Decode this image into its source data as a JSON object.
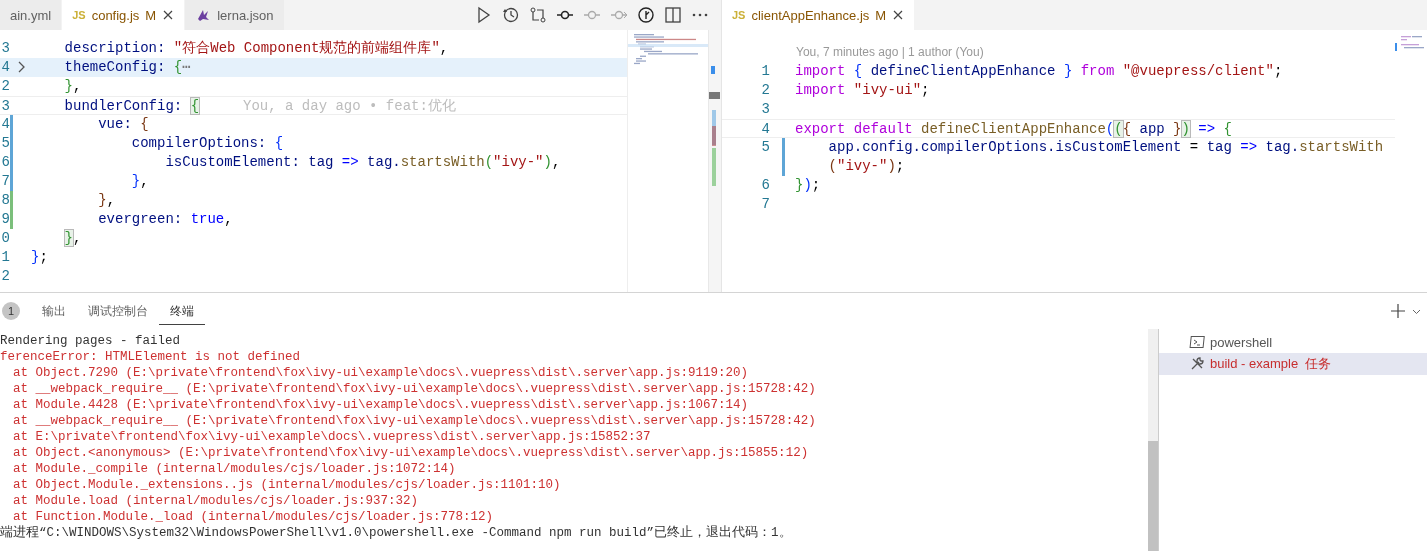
{
  "left_editor": {
    "tabs": [
      {
        "label": "ain.yml",
        "selected": false,
        "modified": false,
        "kind": "plain"
      },
      {
        "label": "config.js",
        "selected": true,
        "modified": true,
        "badge": "M",
        "icon_text": "JS",
        "kind": "js"
      },
      {
        "label": "lerna.json",
        "selected": false,
        "modified": false,
        "kind": "json"
      }
    ],
    "lines": [
      {
        "number": "3",
        "highlighted": false,
        "current": false,
        "folded": false,
        "modified": false,
        "added": false,
        "tokens": [
          {
            "text": "    description: ",
            "kind": "prop"
          },
          {
            "text": "\"符合Web Component规范的前端组件库\"",
            "kind": "str"
          },
          {
            "text": ",",
            "kind": "plain"
          }
        ]
      },
      {
        "number": "4",
        "highlighted": true,
        "current": false,
        "folded": true,
        "modified": false,
        "added": false,
        "tokens": [
          {
            "text": "    themeConfig: ",
            "kind": "prop"
          },
          {
            "text": "{",
            "kind": "b2"
          },
          {
            "text": "⋯",
            "kind": "fold"
          }
        ]
      },
      {
        "number": "2",
        "highlighted": false,
        "current": false,
        "folded": false,
        "modified": false,
        "added": false,
        "tokens": [
          {
            "text": "    }",
            "kind": "b2"
          },
          {
            "text": ",",
            "kind": "plain"
          }
        ]
      },
      {
        "number": "3",
        "highlighted": false,
        "current": true,
        "folded": false,
        "modified": false,
        "added": false,
        "tokens": [
          {
            "text": "    bundlerConfig: ",
            "kind": "prop"
          },
          {
            "text": "{",
            "kind": "match"
          }
        ],
        "blame": "You, a day ago • feat:优化"
      },
      {
        "number": "4",
        "highlighted": false,
        "current": false,
        "folded": false,
        "modified": true,
        "added": false,
        "tokens": [
          {
            "text": "        vue: ",
            "kind": "prop"
          },
          {
            "text": "{",
            "kind": "b3"
          }
        ]
      },
      {
        "number": "5",
        "highlighted": false,
        "current": false,
        "folded": false,
        "modified": true,
        "added": false,
        "tokens": [
          {
            "text": "            compilerOptions: ",
            "kind": "prop"
          },
          {
            "text": "{",
            "kind": "b1"
          }
        ]
      },
      {
        "number": "6",
        "highlighted": false,
        "current": false,
        "folded": false,
        "modified": true,
        "added": false,
        "tokens": [
          {
            "text": "                isCustomElement: ",
            "kind": "prop"
          },
          {
            "text": "tag ",
            "kind": "prop"
          },
          {
            "text": "=>",
            "kind": "kw"
          },
          {
            "text": " tag.",
            "kind": "prop"
          },
          {
            "text": "startsWith",
            "kind": "fn"
          },
          {
            "text": "(",
            "kind": "b2"
          },
          {
            "text": "\"ivy-\"",
            "kind": "str"
          },
          {
            "text": ")",
            "kind": "b2"
          },
          {
            "text": ",",
            "kind": "plain"
          }
        ]
      },
      {
        "number": "7",
        "highlighted": false,
        "current": false,
        "folded": false,
        "modified": true,
        "added": false,
        "tokens": [
          {
            "text": "            }",
            "kind": "b1"
          },
          {
            "text": ",",
            "kind": "plain"
          }
        ]
      },
      {
        "number": "8",
        "highlighted": false,
        "current": false,
        "folded": false,
        "modified": false,
        "added": true,
        "tokens": [
          {
            "text": "        }",
            "kind": "b3"
          },
          {
            "text": ",",
            "kind": "plain"
          }
        ]
      },
      {
        "number": "9",
        "highlighted": false,
        "current": false,
        "folded": false,
        "modified": false,
        "added": true,
        "tokens": [
          {
            "text": "        evergreen: ",
            "kind": "prop"
          },
          {
            "text": "true",
            "kind": "kw"
          },
          {
            "text": ",",
            "kind": "plain"
          }
        ]
      },
      {
        "number": "0",
        "highlighted": false,
        "current": false,
        "folded": false,
        "modified": false,
        "added": false,
        "tokens": [
          {
            "text": "    }",
            "kind": "match"
          },
          {
            "text": ",",
            "kind": "plain"
          }
        ]
      },
      {
        "number": "1",
        "highlighted": false,
        "current": false,
        "folded": false,
        "modified": false,
        "added": false,
        "tokens": [
          {
            "text": "}",
            "kind": "b1"
          },
          {
            "text": ";",
            "kind": "plain"
          }
        ]
      },
      {
        "number": "2",
        "highlighted": false,
        "current": false,
        "folded": false,
        "modified": false,
        "added": false
      }
    ]
  },
  "right_editor": {
    "tabs": [
      {
        "label": "clientAppEnhance.js",
        "selected": true,
        "modified": true,
        "badge": "M",
        "icon_text": "JS",
        "kind": "js"
      }
    ],
    "codelens": "You, 7 minutes ago | 1 author (You)",
    "lines": [
      {
        "number": "1",
        "highlighted": false,
        "current": false,
        "folded": false,
        "modified": false,
        "added": false,
        "tokens": [
          {
            "text": "import",
            "kind": "ctl"
          },
          {
            "text": " {",
            "kind": "b1"
          },
          {
            "text": " defineClientAppEnhance ",
            "kind": "prop"
          },
          {
            "text": "}",
            "kind": "b1"
          },
          {
            "text": " from",
            "kind": "ctl"
          },
          {
            "text": " \"@vuepress/client\"",
            "kind": "str"
          },
          {
            "text": ";",
            "kind": "plain"
          }
        ]
      },
      {
        "number": "2",
        "highlighted": false,
        "current": false,
        "folded": false,
        "modified": false,
        "added": false,
        "tokens": [
          {
            "text": "import",
            "kind": "ctl"
          },
          {
            "text": " \"ivy-ui\"",
            "kind": "str"
          },
          {
            "text": ";",
            "kind": "plain"
          }
        ]
      },
      {
        "number": "3",
        "highlighted": false,
        "current": false,
        "folded": false,
        "modified": false,
        "added": false
      },
      {
        "number": "4",
        "highlighted": false,
        "current": true,
        "folded": false,
        "modified": false,
        "added": false,
        "tokens": [
          {
            "text": "export default",
            "kind": "ctl"
          },
          {
            "text": " defineClientAppEnhance",
            "kind": "fn"
          },
          {
            "text": "(",
            "kind": "b1"
          },
          {
            "text": "(",
            "kind": "match"
          },
          {
            "text": "{",
            "kind": "b3"
          },
          {
            "text": " app ",
            "kind": "prop"
          },
          {
            "text": "}",
            "kind": "b3"
          },
          {
            "text": ")",
            "kind": "match"
          },
          {
            "text": " => ",
            "kind": "kw"
          },
          {
            "text": "{",
            "kind": "b2"
          }
        ]
      },
      {
        "number": "5",
        "highlighted": false,
        "current": false,
        "folded": false,
        "modified": true,
        "added": false,
        "tokens": [
          {
            "text": "    app.config.compilerOptions.isCustomElement",
            "kind": "prop"
          },
          {
            "text": " = ",
            "kind": "plain"
          },
          {
            "text": "tag",
            "kind": "prop"
          },
          {
            "text": " => ",
            "kind": "kw"
          },
          {
            "text": "tag.",
            "kind": "prop"
          },
          {
            "text": "startsWith",
            "kind": "fn"
          },
          {
            "kind": "wrap"
          },
          {
            "text": "(",
            "kind": "b3"
          },
          {
            "text": "\"ivy-\"",
            "kind": "str"
          },
          {
            "text": ")",
            "kind": "b3"
          },
          {
            "text": ";",
            "kind": "plain"
          }
        ]
      },
      {
        "number": "6",
        "highlighted": false,
        "current": false,
        "folded": false,
        "modified": false,
        "added": false,
        "tokens": [
          {
            "text": "}",
            "kind": "b2"
          },
          {
            "text": ")",
            "kind": "b1"
          },
          {
            "text": ";",
            "kind": "plain"
          }
        ]
      },
      {
        "number": "7",
        "highlighted": false,
        "current": false,
        "folded": false,
        "modified": false,
        "added": false
      }
    ]
  },
  "panel": {
    "tabs": [
      {
        "count": "1",
        "selected": false
      },
      {
        "label": "输出",
        "selected": false
      },
      {
        "label": "调试控制台",
        "selected": false
      },
      {
        "label": "终端",
        "selected": true
      }
    ],
    "terminal_lines": [
      {
        "kind": "plain",
        "text": "Rendering pages - failed"
      },
      {
        "kind": "error",
        "text": "ferenceError: HTMLElement is not defined"
      },
      {
        "kind": "stack",
        "text": "at Object.7290 (E:\\private\\frontend\\fox\\ivy-ui\\example\\docs\\.vuepress\\dist\\.server\\app.js:9119:20)"
      },
      {
        "kind": "stack",
        "text": "at __webpack_require__ (E:\\private\\frontend\\fox\\ivy-ui\\example\\docs\\.vuepress\\dist\\.server\\app.js:15728:42)"
      },
      {
        "kind": "stack",
        "text": "at Module.4428 (E:\\private\\frontend\\fox\\ivy-ui\\example\\docs\\.vuepress\\dist\\.server\\app.js:1067:14)"
      },
      {
        "kind": "stack",
        "text": "at __webpack_require__ (E:\\private\\frontend\\fox\\ivy-ui\\example\\docs\\.vuepress\\dist\\.server\\app.js:15728:42)"
      },
      {
        "kind": "stack",
        "text": "at E:\\private\\frontend\\fox\\ivy-ui\\example\\docs\\.vuepress\\dist\\.server\\app.js:15852:37"
      },
      {
        "kind": "stack",
        "text": "at Object.<anonymous> (E:\\private\\frontend\\fox\\ivy-ui\\example\\docs\\.vuepress\\dist\\.server\\app.js:15855:12)"
      },
      {
        "kind": "stack",
        "text": "at Module._compile (internal/modules/cjs/loader.js:1072:14)"
      },
      {
        "kind": "stack",
        "text": "at Object.Module._extensions..js (internal/modules/cjs/loader.js:1101:10)"
      },
      {
        "kind": "stack",
        "text": "at Module.load (internal/modules/cjs/loader.js:937:32)"
      },
      {
        "kind": "stack",
        "text": "at Function.Module._load (internal/modules/cjs/loader.js:778:12)"
      },
      {
        "kind": "plain",
        "text": "端进程“C:\\WINDOWS\\System32\\WindowsPowerShell\\v1.0\\powershell.exe -Command npm run build”已终止，退出代码：1。"
      }
    ],
    "terminals": [
      {
        "label": "powershell",
        "kind": "shell",
        "selected": false
      },
      {
        "label": "build - example  任务",
        "kind": "task",
        "selected": true
      }
    ]
  }
}
